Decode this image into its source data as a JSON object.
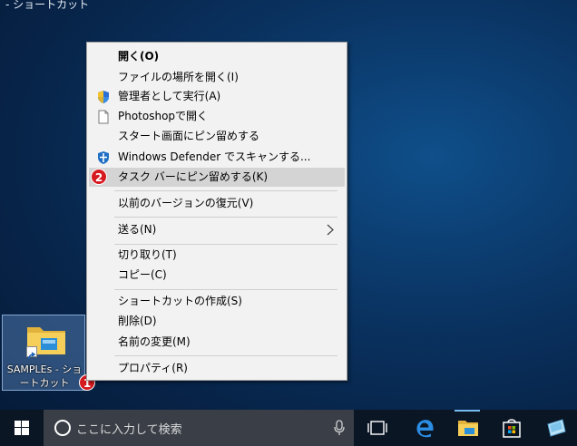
{
  "desktop": {
    "top_label": "- ショートカット",
    "icon_label": "SAMPLEs - ショートカット",
    "badge_1": "1"
  },
  "context_menu": {
    "badge_2": "2",
    "items": [
      {
        "label": "開く(O)",
        "icon": "none"
      },
      {
        "label": "ファイルの場所を開く(I)",
        "icon": "none"
      },
      {
        "label": "管理者として実行(A)",
        "icon": "uac-shield-icon"
      },
      {
        "label": "Photoshopで開く",
        "icon": "document-icon"
      },
      {
        "label": "スタート画面にピン留めする",
        "icon": "none"
      },
      {
        "label": "Windows Defender でスキャンする...",
        "icon": "defender-shield-icon"
      },
      {
        "label": "タスク バーにピン留めする(K)",
        "icon": "badge"
      },
      {
        "label": "以前のバージョンの復元(V)",
        "icon": "none"
      },
      {
        "label": "送る(N)",
        "icon": "none"
      },
      {
        "label": "切り取り(T)",
        "icon": "none"
      },
      {
        "label": "コピー(C)",
        "icon": "none"
      },
      {
        "label": "ショートカットの作成(S)",
        "icon": "none"
      },
      {
        "label": "削除(D)",
        "icon": "none"
      },
      {
        "label": "名前の変更(M)",
        "icon": "none"
      },
      {
        "label": "プロパティ(R)",
        "icon": "none"
      }
    ]
  },
  "taskbar": {
    "search_placeholder": "ここに入力して検索",
    "icons": [
      "windows-start-icon",
      "cortana-icon",
      "microphone-icon",
      "task-view-icon",
      "edge-icon",
      "file-explorer-icon",
      "store-icon",
      "mail-icon"
    ]
  },
  "colors": {
    "highlight": "#d4d4d4",
    "badge": "#d6181f",
    "taskbar": "#0b1624",
    "search_box": "#3a3f47"
  }
}
